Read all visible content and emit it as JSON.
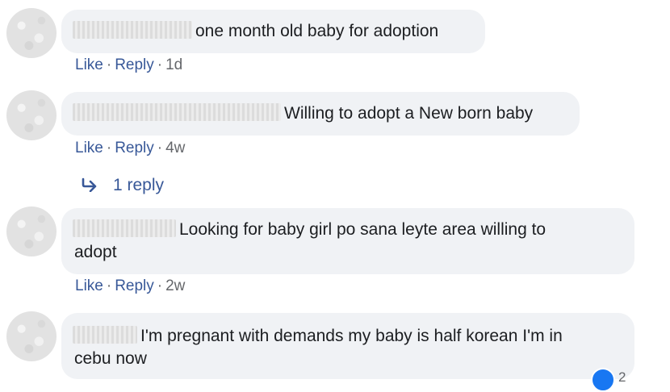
{
  "comments": [
    {
      "text": "one month old baby for adoption",
      "like": "Like",
      "reply": "Reply",
      "time": "1d"
    },
    {
      "text": "Willing to adopt a New born baby",
      "like": "Like",
      "reply": "Reply",
      "time": "4w",
      "replies_label": "1 reply"
    },
    {
      "text_line1": "Looking for baby girl po sana leyte area willing to",
      "text_line2": "adopt",
      "like": "Like",
      "reply": "Reply",
      "time": "2w"
    },
    {
      "text_line1": "I'm pregnant with demands my baby is half korean I'm in",
      "text_line2": "cebu now",
      "reaction_count": "2"
    }
  ],
  "separator": "·",
  "colors": {
    "bubble": "#f0f2f5",
    "link": "#385898",
    "meta": "#65676b"
  },
  "icons": {
    "reply_arrow": "reply-arrow-icon",
    "like_reaction": "like-reaction-icon"
  }
}
